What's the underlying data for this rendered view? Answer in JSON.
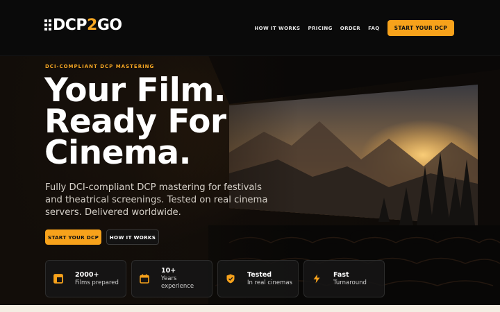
{
  "brand": {
    "logo_left": "DCP",
    "logo_mid": "2",
    "logo_right": "GO"
  },
  "nav": {
    "items": [
      {
        "label": "HOW IT WORKS"
      },
      {
        "label": "PRICING"
      },
      {
        "label": "ORDER"
      },
      {
        "label": "FAQ"
      }
    ],
    "cta_label": "START YOUR DCP"
  },
  "hero": {
    "eyebrow": "DCI-COMPLIANT DCP MASTERING",
    "headline": [
      "Your Film.",
      "Ready For",
      "Cinema."
    ],
    "subtitle": "Fully DCI-compliant DCP mastering for festivals and theatrical screenings. Tested on real cinema servers. Delivered worldwide.",
    "primary_button": "START YOUR DCP",
    "secondary_button": "HOW IT WORKS"
  },
  "stats": [
    {
      "value": "2000+",
      "label": "Films prepared",
      "icon": "layout-icon"
    },
    {
      "value": "10+",
      "label": "Years experience",
      "icon": "calendar-icon"
    },
    {
      "value": "Tested",
      "label": "In real cinemas",
      "icon": "shield-check-icon"
    },
    {
      "value": "Fast",
      "label": "Turnaround",
      "icon": "lightning-icon"
    }
  ],
  "colors": {
    "accent": "#f7a21b",
    "background": "#0b0b0b",
    "text": "#ffffff"
  }
}
